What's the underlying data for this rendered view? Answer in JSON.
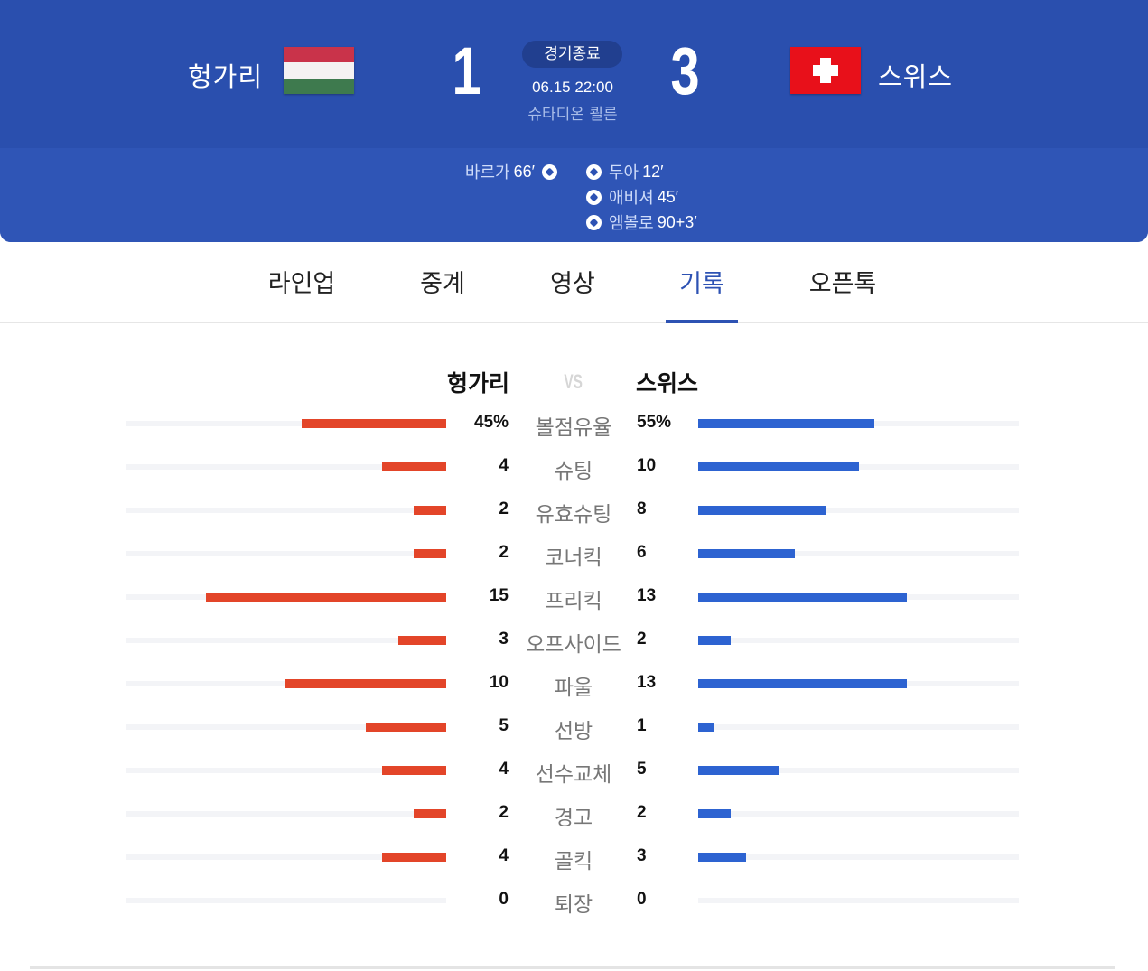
{
  "match": {
    "status": "경기종료",
    "datetime": "06.15 22:00",
    "venue": "슈타디온 쾰른",
    "home": {
      "name": "헝가리",
      "score": "1"
    },
    "away": {
      "name": "스위스",
      "score": "3"
    }
  },
  "goals": {
    "home": [
      {
        "player": "바르가",
        "minute": "66′"
      }
    ],
    "away": [
      {
        "player": "두아",
        "minute": "12′"
      },
      {
        "player": "애비셔",
        "minute": "45′"
      },
      {
        "player": "엠볼로",
        "minute": "90+3′"
      }
    ]
  },
  "tabs": [
    "라인업",
    "중계",
    "영상",
    "기록",
    "오픈톡"
  ],
  "active_tab": "기록",
  "stats_header": {
    "home": "헝가리",
    "vs": "VS",
    "away": "스위스"
  },
  "stats": [
    {
      "label": "볼점유율",
      "home": "45%",
      "away": "55%",
      "home_share": 0.45,
      "away_share": 0.55
    },
    {
      "label": "슈팅",
      "home": "4",
      "away": "10",
      "home_share": 0.2,
      "away_share": 0.5
    },
    {
      "label": "유효슈팅",
      "home": "2",
      "away": "8",
      "home_share": 0.1,
      "away_share": 0.4
    },
    {
      "label": "코너킥",
      "home": "2",
      "away": "6",
      "home_share": 0.1,
      "away_share": 0.3
    },
    {
      "label": "프리킥",
      "home": "15",
      "away": "13",
      "home_share": 0.75,
      "away_share": 0.65
    },
    {
      "label": "오프사이드",
      "home": "3",
      "away": "2",
      "home_share": 0.15,
      "away_share": 0.1
    },
    {
      "label": "파울",
      "home": "10",
      "away": "13",
      "home_share": 0.5,
      "away_share": 0.65
    },
    {
      "label": "선방",
      "home": "5",
      "away": "1",
      "home_share": 0.25,
      "away_share": 0.05
    },
    {
      "label": "선수교체",
      "home": "4",
      "away": "5",
      "home_share": 0.2,
      "away_share": 0.25
    },
    {
      "label": "경고",
      "home": "2",
      "away": "2",
      "home_share": 0.1,
      "away_share": 0.1
    },
    {
      "label": "골킥",
      "home": "4",
      "away": "3",
      "home_share": 0.2,
      "away_share": 0.15
    },
    {
      "label": "퇴장",
      "home": "0",
      "away": "0",
      "home_share": 0,
      "away_share": 0
    }
  ],
  "colors": {
    "header_bg": "#2a4fae",
    "home_bar": "#e34529",
    "away_bar": "#2d63d1",
    "accent": "#2d52b3"
  },
  "icons": {
    "goal": "soccer-ball-icon"
  }
}
